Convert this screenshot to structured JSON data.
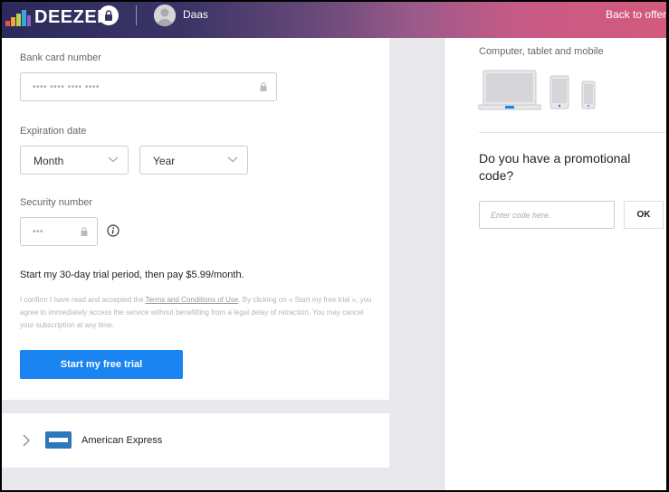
{
  "header": {
    "logo_text": "DEEZER",
    "username": "Daas",
    "back_link": "Back to offers",
    "brand_bar_colors": [
      "#e4534c",
      "#f3a43b",
      "#b7d34f",
      "#3aa7d9",
      "#8e60c3"
    ]
  },
  "payment_form": {
    "card_number": {
      "label": "Bank card number",
      "placeholder": "•••• •••• •••• ••••",
      "icon": "lock-icon"
    },
    "expiration": {
      "label": "Expiration date",
      "month": {
        "value": "Month",
        "icon": "chevron-down-icon"
      },
      "year": {
        "value": "Year",
        "icon": "chevron-down-icon"
      }
    },
    "security": {
      "label": "Security number",
      "placeholder": "•••",
      "icon": "lock-icon",
      "help_icon": "info-icon"
    },
    "trial_text": "Start my 30-day trial period, then pay $5.99/month.",
    "legal": {
      "before": "I confirm I have read and accepted the ",
      "link": "Terms and Conditions of Use",
      "after": ". By clicking on « Start my free trial », you agree to immediately access the service without benefitting from a legal delay of retraction. You may cancel your subscription at any time."
    },
    "submit_label": "Start my free trial",
    "accent_color": "#1a84f0"
  },
  "payment_methods": [
    {
      "label": "American Express",
      "icon": "amex-card-icon"
    }
  ],
  "sidebar": {
    "devices_title": "Computer, tablet and mobile",
    "devices": [
      "laptop-icon",
      "tablet-icon",
      "phone-icon"
    ],
    "promo": {
      "title": "Do you have a promotional code?",
      "placeholder": "Enter code here.",
      "button_label": "OK"
    }
  }
}
